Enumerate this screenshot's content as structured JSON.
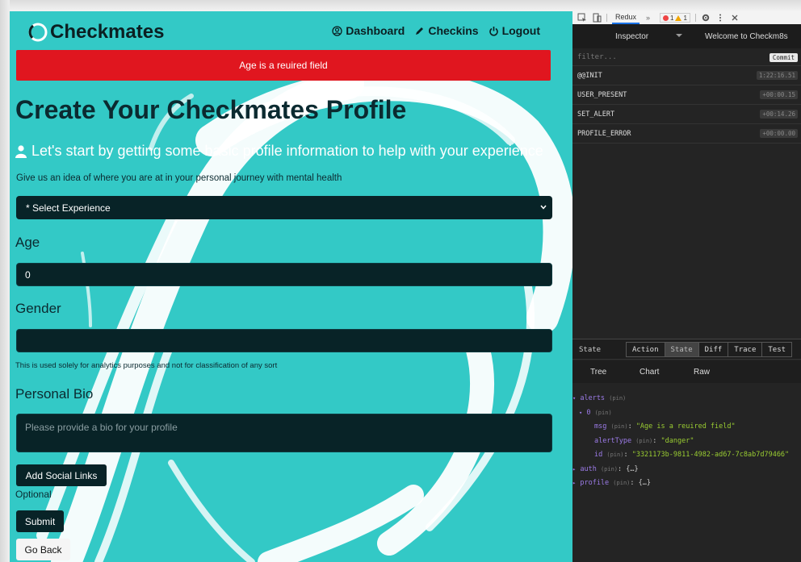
{
  "app": {
    "brand": "Checkmates",
    "nav": [
      "Dashboard",
      "Checkins",
      "Logout"
    ],
    "alert": "Age is a reuired field",
    "title": "Create Your Checkmates Profile",
    "lead": "Let's start by getting some basic profile information to help with your experience",
    "hint": "Give us an idea of where you are at in your personal journey with mental health",
    "experience_select": "* Select Experience",
    "age_label": "Age",
    "age_value": "0",
    "gender_label": "Gender",
    "gender_value": "",
    "gender_note": "This is used solely for analytics purposes and not for classification of any sort",
    "bio_label": "Personal Bio",
    "bio_placeholder": "Please provide a bio for your profile",
    "social_button": "Add Social Links",
    "optional": "Optional",
    "submit_button": "Submit",
    "back_button": "Go Back",
    "colors": {
      "background": "#33c9c6",
      "dark": "#082327",
      "alert": "#e0161f"
    }
  },
  "devtools": {
    "tab": "Redux",
    "more": "»",
    "errors": "1",
    "warnings": "1",
    "inspector": "Inspector",
    "instance": "Welcome to Checkm8s",
    "filter_placeholder": "filter...",
    "commit": "Commit",
    "actions": [
      {
        "name": "@@INIT",
        "time": "1:22:16.51"
      },
      {
        "name": "USER_PRESENT",
        "time": "+00:00.15"
      },
      {
        "name": "SET_ALERT",
        "time": "+00:14.26"
      },
      {
        "name": "PROFILE_ERROR",
        "time": "+00:00.00"
      }
    ],
    "state_label": "State",
    "state_tabs": [
      "Action",
      "State",
      "Diff",
      "Trace",
      "Test"
    ],
    "view_tabs": [
      "Tree",
      "Chart",
      "Raw"
    ],
    "tree": {
      "alerts": "alerts",
      "index": "0",
      "pin": "(pin)",
      "msg_key": "msg",
      "msg_val": "\"Age is a reuired field\"",
      "type_key": "alertType",
      "type_val": "\"danger\"",
      "id_key": "id",
      "id_val": "\"3321173b-9811-4982-ad67-7c8ab7d79466\"",
      "auth": "auth",
      "profile": "profile",
      "collapsed": "{…}"
    }
  }
}
